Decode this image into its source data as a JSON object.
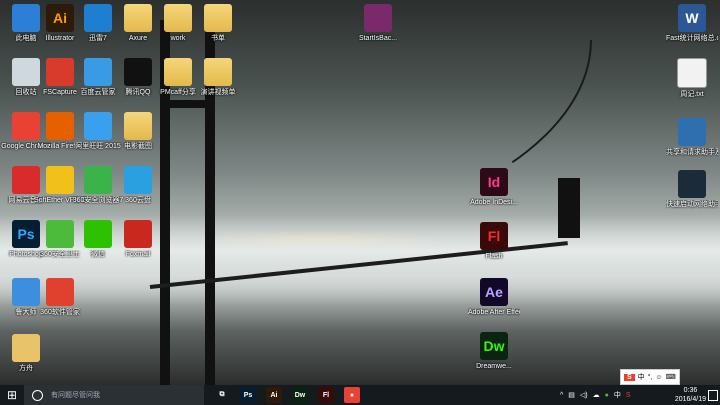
{
  "desktop": {
    "icons": [
      {
        "label": "此电脑",
        "icon": "computer-icon",
        "color": "#2c7fd6"
      },
      {
        "label": "Illustrator",
        "icon": "ai-icon",
        "color": "#2d1a08",
        "text": "Ai",
        "textcolor": "#ff9a00"
      },
      {
        "label": "迅雷7",
        "icon": "thunder-icon",
        "color": "#1f7ed0"
      },
      {
        "label": "Axure",
        "icon": "folder-icon",
        "color": "folder"
      },
      {
        "label": "work",
        "icon": "folder-icon",
        "color": "folder"
      },
      {
        "label": "书单",
        "icon": "folder-icon",
        "color": "folder"
      },
      {
        "label": "回收站",
        "icon": "recycle-bin-icon",
        "color": "#cfd8dc"
      },
      {
        "label": "FSCapture",
        "icon": "fscapture-icon",
        "color": "#d83b2b"
      },
      {
        "label": "百度云管家",
        "icon": "baidu-cloud-icon",
        "color": "#3a9be5"
      },
      {
        "label": "腾讯QQ",
        "icon": "qq-icon",
        "color": "#111111"
      },
      {
        "label": "PMcaff分享",
        "icon": "folder-icon",
        "color": "folder"
      },
      {
        "label": "演讲视频单",
        "icon": "folder-icon",
        "color": "folder"
      },
      {
        "label": "Google Chrome",
        "icon": "chrome-icon",
        "color": "#e94235"
      },
      {
        "label": "Mozilla Firefox",
        "icon": "firefox-icon",
        "color": "#e66000"
      },
      {
        "label": "阿里旺旺 2015",
        "icon": "aliwangwang-icon",
        "color": "#3aa0ee"
      },
      {
        "label": "电影截图",
        "icon": "film-folder-icon",
        "color": "folder"
      },
      {
        "label": "网易云音乐",
        "icon": "netease-music-icon",
        "color": "#d92b2b"
      },
      {
        "label": "SoftEther VPN Clie...",
        "icon": "softether-icon",
        "color": "#f2c01b"
      },
      {
        "label": "360安全浏览器7",
        "icon": "360-browser-icon",
        "color": "#3cb34a"
      },
      {
        "label": "360云盘",
        "icon": "360-cloud-icon",
        "color": "#2aa0e0"
      },
      {
        "label": "Photoshop",
        "icon": "photoshop-icon",
        "color": "#061e31",
        "text": "Ps",
        "textcolor": "#31a8ff"
      },
      {
        "label": "360安全卫士",
        "icon": "360-guard-icon",
        "color": "#4cba3a"
      },
      {
        "label": "微信",
        "icon": "wechat-icon",
        "color": "#2dc100"
      },
      {
        "label": "Foxmail",
        "icon": "foxmail-icon",
        "color": "#c8281e"
      },
      {
        "label": "鲁大师",
        "icon": "ludashi-icon",
        "color": "#3d8ede"
      },
      {
        "label": "360软件管家",
        "icon": "360-software-icon",
        "color": "#e0412f"
      },
      {
        "label": "方舟",
        "icon": "fangzhou-icon",
        "color": "#e8c36a"
      },
      {
        "label": "StartIsBac...",
        "icon": "winrar-icon",
        "color": "#7a2a6a"
      },
      {
        "label": "Adobe InDesi...",
        "icon": "indesign-icon",
        "color": "#2c0a17",
        "text": "Id",
        "textcolor": "#ff3d8b"
      },
      {
        "label": "Flash",
        "icon": "flash-icon",
        "color": "#3a0a0a",
        "text": "Fl",
        "textcolor": "#ff2a2a"
      },
      {
        "label": "Adobe After Effects CS6",
        "icon": "after-effects-icon",
        "color": "#12092a",
        "text": "Ae",
        "textcolor": "#b6a4ff"
      },
      {
        "label": "Dreamwe...",
        "icon": "dreamweaver-icon",
        "color": "#0b2411",
        "text": "Dw",
        "textcolor": "#35fa00"
      },
      {
        "label": "Fast统计网络总.docx",
        "icon": "word-doc-icon",
        "color": "#2b5797",
        "text": "W"
      },
      {
        "label": "周记.txt",
        "icon": "text-file-icon",
        "color": "#f2f2f2"
      },
      {
        "label": "共享和请求助手及更多...",
        "icon": "network-share-icon",
        "color": "#2f6fb0"
      },
      {
        "label": "快速启动网络助手",
        "icon": "helper-icon",
        "color": "#1b2b3a"
      }
    ]
  },
  "taskbar": {
    "search_placeholder": "有问题尽管问我",
    "apps": [
      {
        "icon": "task-view-icon",
        "text": "⧉",
        "color": "#141a1d"
      },
      {
        "icon": "photoshop-icon",
        "text": "Ps",
        "color": "#061e31"
      },
      {
        "icon": "illustrator-icon",
        "text": "Ai",
        "color": "#2d1a08"
      },
      {
        "icon": "dreamweaver-icon",
        "text": "Dw",
        "color": "#0b2411"
      },
      {
        "icon": "flash-icon",
        "text": "Fl",
        "color": "#3a0a0a"
      },
      {
        "icon": "chrome-icon",
        "text": "●",
        "color": "#e94235"
      }
    ],
    "clock_time": "0:36",
    "clock_date": "2016/4/19",
    "ime": {
      "logo": "S",
      "mode": "中"
    }
  }
}
